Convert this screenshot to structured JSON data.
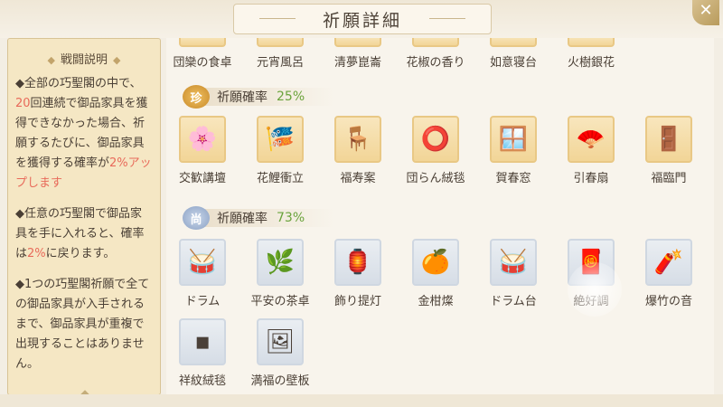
{
  "header": {
    "title": "祈願詳細",
    "close_label": "✕"
  },
  "left_panel": {
    "title": "戦闘説明",
    "para1": {
      "a": "◆全部の巧聖閣の中で、",
      "b": "20",
      "c": "回連続で御品家具を獲得できなかった場合、祈願するたびに、御品家具を獲得する確率が",
      "d": "2%アップします"
    },
    "para2": {
      "a": "◆任意の巧聖閣で御品家具を手に入れると、確率は",
      "b": "2%",
      "c": "に戻ります。"
    },
    "para3": "◆1つの巧聖閣祈願で全ての御品家具が入手されるまで、御品家具が重複で出現することはありません。"
  },
  "top_row": [
    {
      "name": "団欒の食卓"
    },
    {
      "name": "元宵風呂"
    },
    {
      "name": "清夢崑崙"
    },
    {
      "name": "花椒の香り"
    },
    {
      "name": "如意寝台"
    },
    {
      "name": "火樹銀花"
    }
  ],
  "rare": {
    "badge": "珍",
    "label": "祈願確率",
    "value": "25%",
    "items": [
      {
        "name": "交歓講壇",
        "icon": "🌸"
      },
      {
        "name": "花鯉衝立",
        "icon": "🎏"
      },
      {
        "name": "福寿案",
        "icon": "🪑"
      },
      {
        "name": "団らん絨毯",
        "icon": "⭕"
      },
      {
        "name": "賀春窓",
        "icon": "🪟"
      },
      {
        "name": "引春扇",
        "icon": "🪭"
      },
      {
        "name": "福臨門",
        "icon": "🚪"
      }
    ]
  },
  "common": {
    "badge": "尚",
    "label": "祈願確率",
    "value": "73%",
    "items": [
      {
        "name": "ドラム",
        "icon": "🥁"
      },
      {
        "name": "平安の茶卓",
        "icon": "🌿"
      },
      {
        "name": "飾り提灯",
        "icon": "🏮"
      },
      {
        "name": "金柑燦",
        "icon": "🍊"
      },
      {
        "name": "ドラム台",
        "icon": "🥁"
      },
      {
        "name": "絶好調",
        "icon": "🧧"
      },
      {
        "name": "爆竹の音",
        "icon": "🧨"
      },
      {
        "name": "祥紋絨毯",
        "icon": "▪"
      },
      {
        "name": "満福の壁板",
        "icon": "🖼"
      }
    ]
  },
  "colors": {
    "highlight": "#e86a5a",
    "rate_value": "#6aa33c",
    "gold_frame": "#e9c885",
    "grey_frame": "#cfd7e1"
  }
}
